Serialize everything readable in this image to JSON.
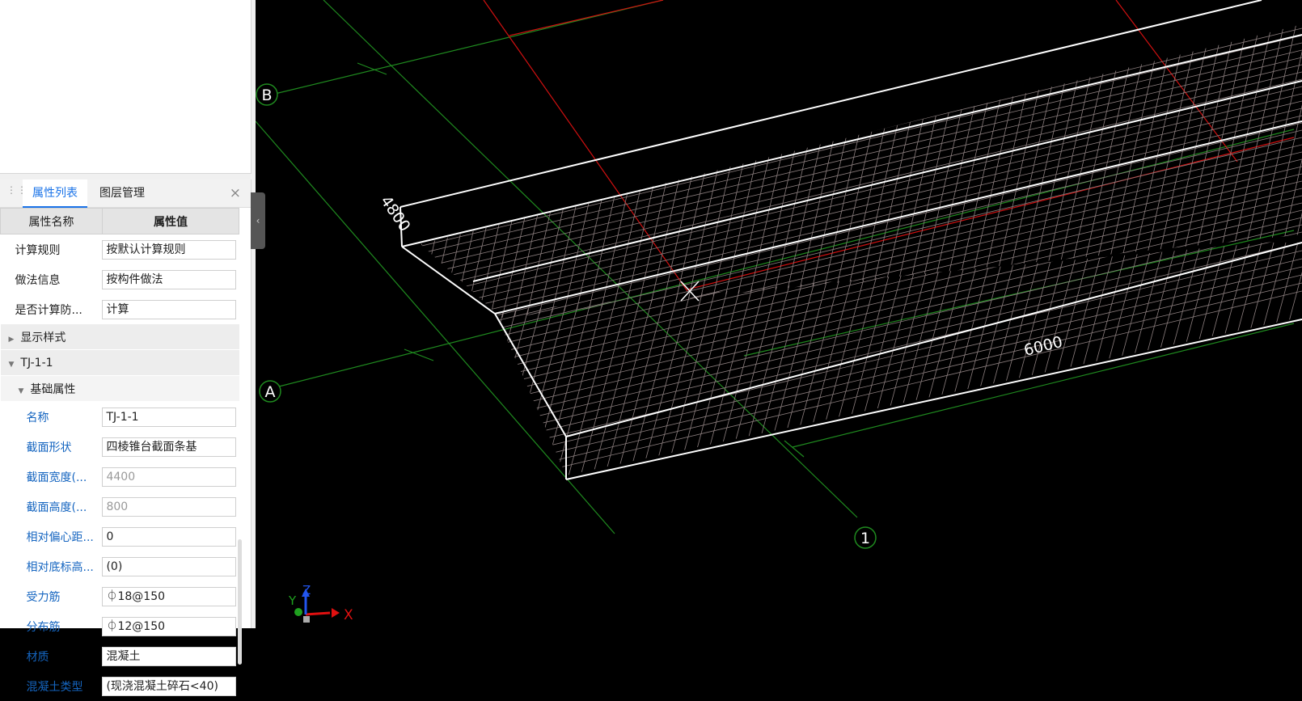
{
  "panel": {
    "tabs": [
      {
        "label": "属性列表",
        "active": true
      },
      {
        "label": "图层管理",
        "active": false
      }
    ],
    "close_glyph": "×",
    "header": {
      "name": "属性名称",
      "value": "属性值"
    },
    "rows_top": [
      {
        "name": "计算规则",
        "value": "按默认计算规则"
      },
      {
        "name": "做法信息",
        "value": "按构件做法"
      },
      {
        "name": "是否计算防...",
        "value": "计算"
      }
    ],
    "group_display": "显示样式",
    "group_element": "TJ-1-1",
    "group_basic": "基础属性",
    "rows_basic": [
      {
        "name": "名称",
        "value": "TJ-1-1",
        "grey": false
      },
      {
        "name": "截面形状",
        "value": "四棱锥台截面条基",
        "grey": false
      },
      {
        "name": "截面宽度(...",
        "value": "4400",
        "grey": true
      },
      {
        "name": "截面高度(...",
        "value": "800",
        "grey": true
      },
      {
        "name": "相对偏心距...",
        "value": "0",
        "grey": false
      },
      {
        "name": "相对底标高...",
        "value": "(0)",
        "grey": false
      },
      {
        "name": "受力筋",
        "value": "⏀18@150",
        "grey": false
      },
      {
        "name": "分布筋",
        "value": "⏀12@150",
        "grey": false
      },
      {
        "name": "材质",
        "value": "混凝土",
        "grey": false
      },
      {
        "name": "混凝土类型",
        "value": "(现浇混凝土碎石<40)",
        "grey": false
      }
    ]
  },
  "viewport": {
    "axis_labels": {
      "B": "B",
      "A": "A",
      "one": "1"
    },
    "dims": {
      "width": "4800",
      "length": "6000"
    },
    "triad": {
      "x": "X",
      "y": "Y",
      "z": "Z"
    },
    "colors": {
      "grid": "#1f8a1f",
      "axis_red": "#d01010",
      "mesh": "#8c7f7f",
      "edge": "#ffffff"
    }
  }
}
